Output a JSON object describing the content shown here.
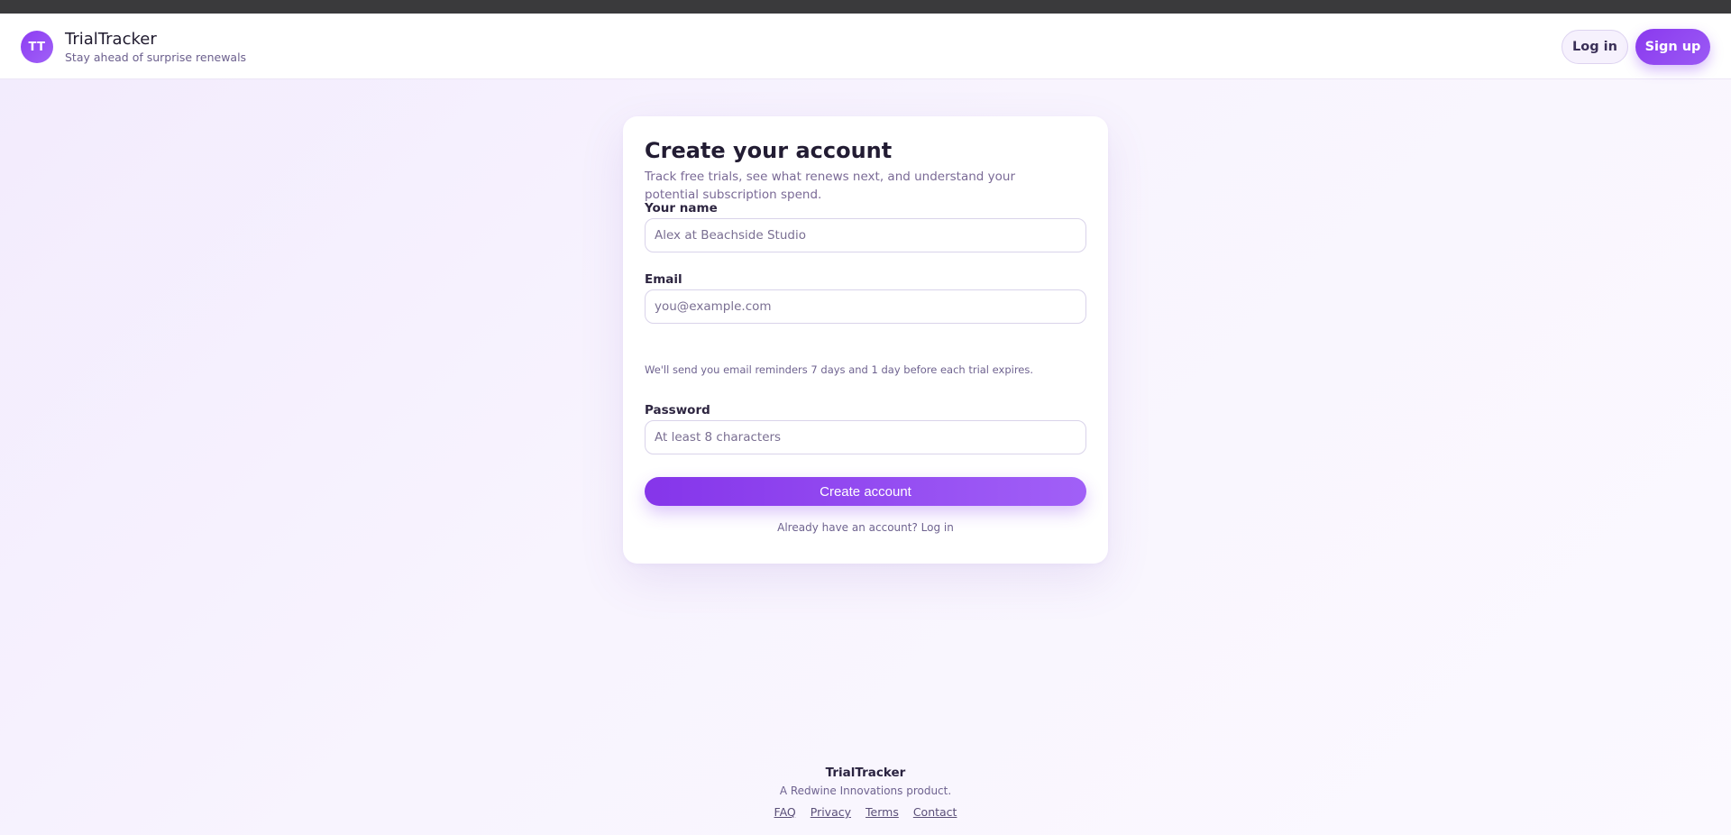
{
  "header": {
    "logo_initials": "TT",
    "brand_name": "TrialTracker",
    "tagline": "Stay ahead of surprise renewals",
    "login_label": "Log in",
    "signup_label": "Sign up"
  },
  "form": {
    "title": "Create your account",
    "subtitle": "Track free trials, see what renews next, and understand your potential subscription spend.",
    "name_label": "Your name",
    "name_placeholder": "Alex at Beachside Studio",
    "email_label": "Email",
    "email_placeholder": "you@example.com",
    "email_hint": "We'll send you email reminders 7 days and 1 day before each trial expires.",
    "password_label": "Password",
    "password_placeholder": "At least 8 characters",
    "submit_label": "Create account",
    "already_text": "Already have an account?",
    "already_link": "Log in"
  },
  "footer": {
    "brand": "TrialTracker",
    "note": "A Redwine Innovations product.",
    "links": [
      "FAQ",
      "Privacy",
      "Terms",
      "Contact"
    ]
  },
  "colors": {
    "accent": "#8d3cf2",
    "accent_light": "#a062f7",
    "background": "#f5f0fd"
  }
}
